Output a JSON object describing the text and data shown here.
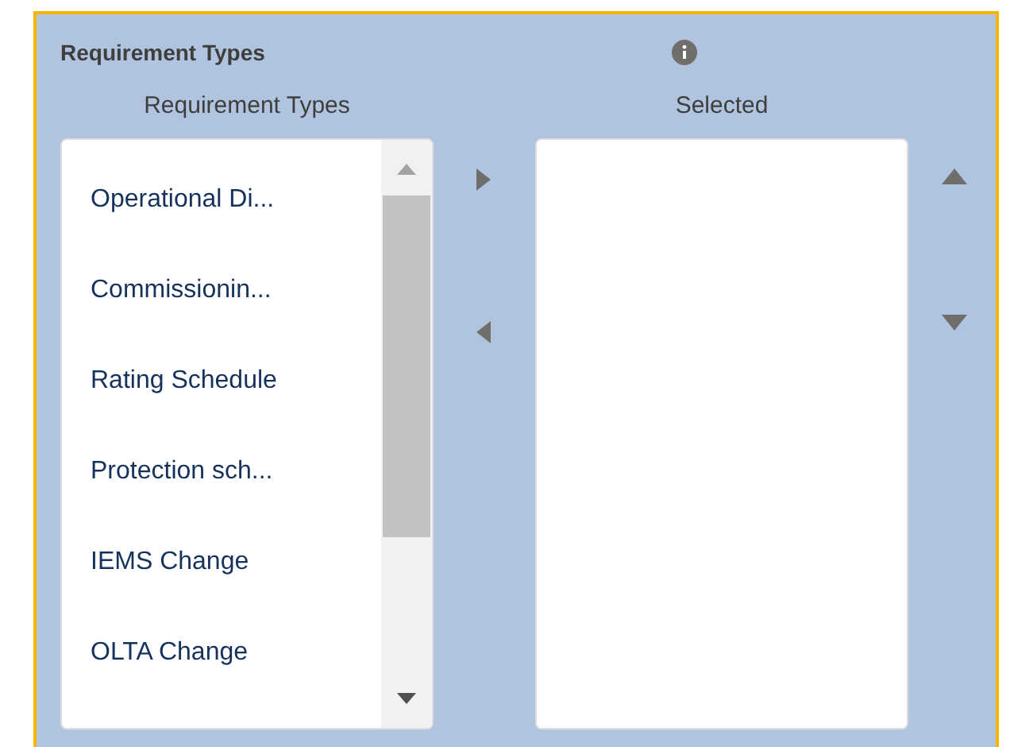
{
  "title": "Requirement Types",
  "available": {
    "label": "Requirement Types",
    "items": [
      {
        "label": "Operational Di..."
      },
      {
        "label": "Commissionin..."
      },
      {
        "label": "Rating Schedule"
      },
      {
        "label": "Protection sch..."
      },
      {
        "label": "IEMS Change"
      },
      {
        "label": "OLTA Change"
      }
    ]
  },
  "chosen": {
    "label": "Selected"
  }
}
